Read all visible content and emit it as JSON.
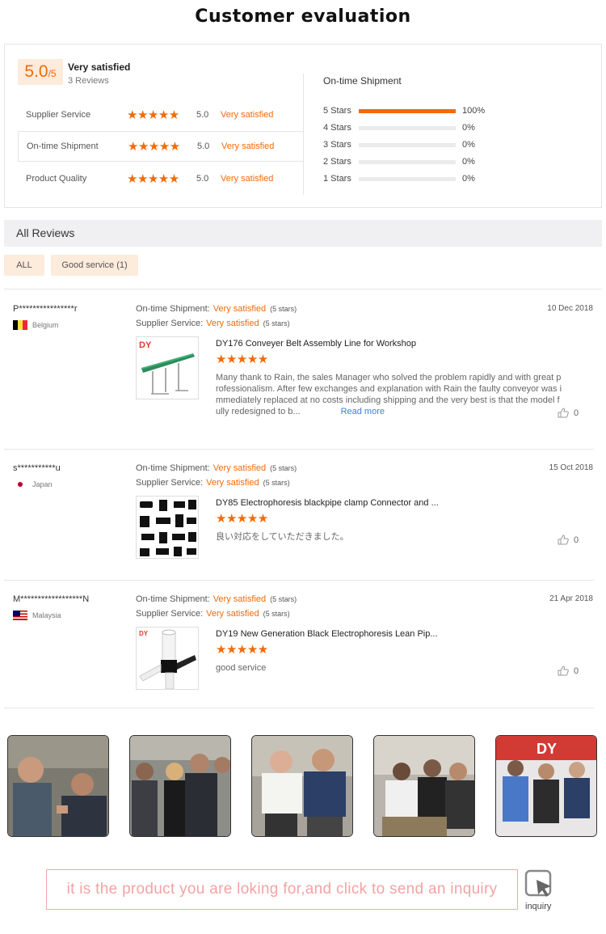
{
  "page_title": "Customer evaluation",
  "summary": {
    "score": "5.0",
    "score_denominator": "/5",
    "overall_label": "Very satisfied",
    "review_count": "3 Reviews",
    "metrics": [
      {
        "label": "Supplier Service",
        "stars": "★★★★★",
        "score": "5.0",
        "text": "Very satisfied"
      },
      {
        "label": "On-time Shipment",
        "stars": "★★★★★",
        "score": "5.0",
        "text": "Very satisfied"
      },
      {
        "label": "Product Quality",
        "stars": "★★★★★",
        "score": "5.0",
        "text": "Very satisfied"
      }
    ],
    "distribution_title": "On-time Shipment",
    "distribution": [
      {
        "label": "5  Stars",
        "percent": "100%",
        "fraction": 1.0
      },
      {
        "label": "4  Stars",
        "percent": "0%",
        "fraction": 0
      },
      {
        "label": "3  Stars",
        "percent": "0%",
        "fraction": 0
      },
      {
        "label": "2  Stars",
        "percent": "0%",
        "fraction": 0
      },
      {
        "label": "1  Stars",
        "percent": "0%",
        "fraction": 0
      }
    ]
  },
  "reviews_section": {
    "title": "All Reviews",
    "filters": [
      "ALL",
      "Good service (1)"
    ]
  },
  "reviews": [
    {
      "user": "P****************r",
      "country": "Belgium",
      "shipment_label": "On-time Shipment:",
      "shipment_value": "Very satisfied",
      "shipment_stars": "(5 stars)",
      "supplier_label": "Supplier Service:",
      "supplier_value": "Very satisfied",
      "supplier_stars": "(5 stars)",
      "date": "10 Dec 2018",
      "product": "DY176 Conveyer Belt Assembly Line for Workshop",
      "rating": "★★★★★",
      "text": "Many thank to Rain, the sales Manager who solved the problem rapidly and with great professionalism. After few exchanges and explanation with Rain the faulty conveyor was immediately replaced at no costs including shipping and the very best is that the model fully redesigned to b...",
      "read_more": "Read more",
      "likes": "0"
    },
    {
      "user": "s***********u",
      "country": "Japan",
      "shipment_label": "On-time Shipment:",
      "shipment_value": "Very satisfied",
      "shipment_stars": "(5 stars)",
      "supplier_label": "Supplier Service:",
      "supplier_value": "Very satisfied",
      "supplier_stars": "(5 stars)",
      "date": "15 Oct 2018",
      "product": "DY85 Electrophoresis blackpipe clamp Connector and ...",
      "rating": "★★★★★",
      "text": "良い対応をしていただきました。",
      "likes": "0"
    },
    {
      "user": "M******************N",
      "country": "Malaysia",
      "shipment_label": "On-time Shipment:",
      "shipment_value": "Very satisfied",
      "shipment_stars": "(5 stars)",
      "supplier_label": "Supplier Service:",
      "supplier_value": "Very satisfied",
      "supplier_stars": "(5 stars)",
      "date": "21 Apr 2018",
      "product": "DY19 New Generation Black Electrophoresis Lean Pip...",
      "rating": "★★★★★",
      "text": "good service",
      "likes": "0"
    }
  ],
  "brand_logo": "DY",
  "inquiry": {
    "banner": "it is the product you are loking for,and click to send an inquiry",
    "label": "inquiry"
  },
  "colors": {
    "accent": "#f26a0a",
    "accent_light": "#fdebdc",
    "link": "#3d7fd6",
    "inquiry": "#f4a3a3"
  }
}
